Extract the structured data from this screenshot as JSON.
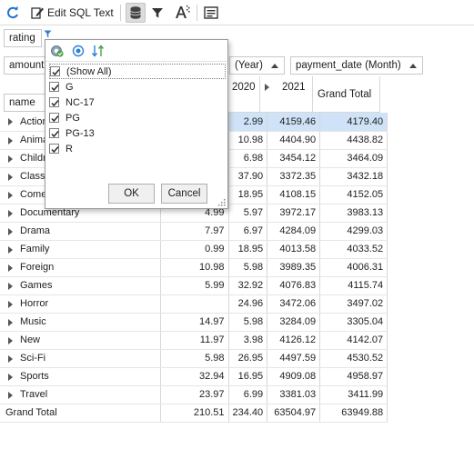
{
  "toolbar": {
    "edit_sql_label": "Edit SQL Text"
  },
  "filter_field": "rating",
  "chips": {
    "amount": "amount",
    "payment_year": "(Year)",
    "payment_month": "payment_date (Month)"
  },
  "columns": {
    "c2020": "2020",
    "c2021": "2021",
    "grand_total": "Grand Total",
    "row_field": "name"
  },
  "rows": [
    {
      "name": "Action",
      "c2019": "",
      "c2020": "2.99",
      "c2021": "4159.46",
      "total": "4179.40"
    },
    {
      "name": "Animation",
      "c2019": "",
      "c2020": "10.98",
      "c2021": "4404.90",
      "total": "4438.82"
    },
    {
      "name": "Children",
      "c2019": "",
      "c2020": "6.98",
      "c2021": "3454.12",
      "total": "3464.09"
    },
    {
      "name": "Classics",
      "c2019": "",
      "c2020": "37.90",
      "c2021": "3372.35",
      "total": "3432.18"
    },
    {
      "name": "Comedy",
      "c2019": "",
      "c2020": "18.95",
      "c2021": "4108.15",
      "total": "4152.05"
    },
    {
      "name": "Documentary",
      "c2019": "4.99",
      "c2020": "5.97",
      "c2021": "3972.17",
      "total": "3983.13"
    },
    {
      "name": "Drama",
      "c2019": "7.97",
      "c2020": "6.97",
      "c2021": "4284.09",
      "total": "4299.03"
    },
    {
      "name": "Family",
      "c2019": "0.99",
      "c2020": "18.95",
      "c2021": "4013.58",
      "total": "4033.52"
    },
    {
      "name": "Foreign",
      "c2019": "10.98",
      "c2020": "5.98",
      "c2021": "3989.35",
      "total": "4006.31"
    },
    {
      "name": "Games",
      "c2019": "5.99",
      "c2020": "32.92",
      "c2021": "4076.83",
      "total": "4115.74"
    },
    {
      "name": "Horror",
      "c2019": "",
      "c2020": "24.96",
      "c2021": "3472.06",
      "total": "3497.02"
    },
    {
      "name": "Music",
      "c2019": "14.97",
      "c2020": "5.98",
      "c2021": "3284.09",
      "total": "3305.04"
    },
    {
      "name": "New",
      "c2019": "11.97",
      "c2020": "3.98",
      "c2021": "4126.12",
      "total": "4142.07"
    },
    {
      "name": "Sci-Fi",
      "c2019": "5.98",
      "c2020": "26.95",
      "c2021": "4497.59",
      "total": "4530.52"
    },
    {
      "name": "Sports",
      "c2019": "32.94",
      "c2020": "16.95",
      "c2021": "4909.08",
      "total": "4958.97"
    },
    {
      "name": "Travel",
      "c2019": "23.97",
      "c2020": "6.99",
      "c2021": "3381.03",
      "total": "3411.99"
    }
  ],
  "grand_total_row": {
    "label": "Grand Total",
    "c2019": "210.51",
    "c2020": "234.40",
    "c2021": "63504.97",
    "total": "63949.88"
  },
  "popup": {
    "items": [
      {
        "label": "(Show All)",
        "checked": true
      },
      {
        "label": "G",
        "checked": true
      },
      {
        "label": "NC-17",
        "checked": true
      },
      {
        "label": "PG",
        "checked": true
      },
      {
        "label": "PG-13",
        "checked": true
      },
      {
        "label": "R",
        "checked": true
      }
    ],
    "ok_label": "OK",
    "cancel_label": "Cancel"
  },
  "colors": {
    "accent": "#1e73d2",
    "selection": "#cfe2f7",
    "filter_icon": "#2f7fd6"
  }
}
